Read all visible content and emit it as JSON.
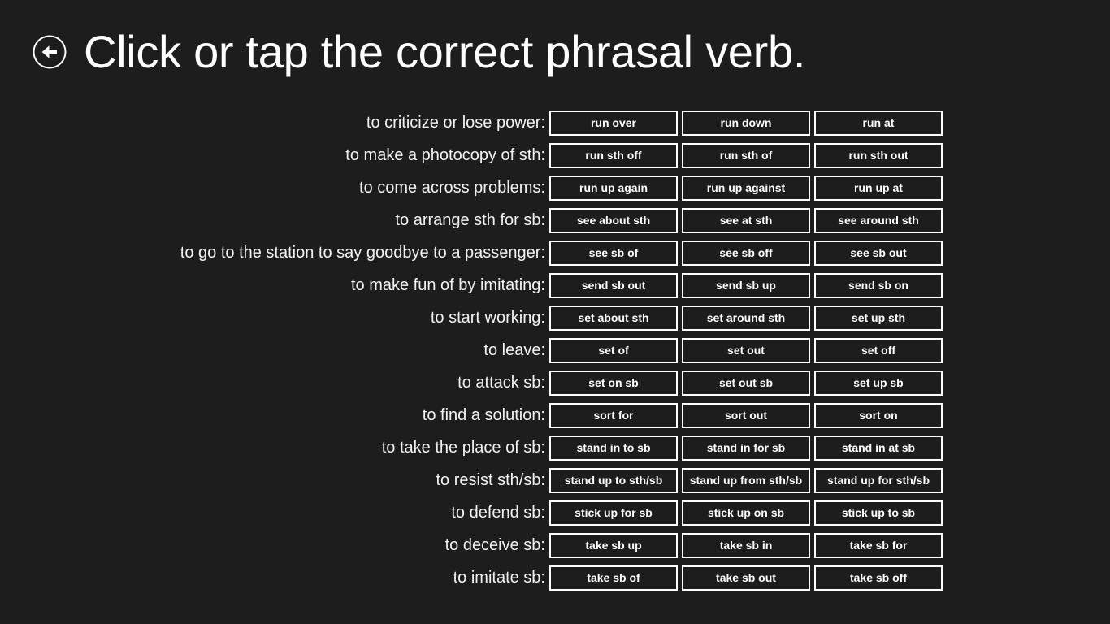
{
  "header": {
    "back_icon": "back-arrow-circle-icon",
    "title": "Click or tap the correct phrasal verb."
  },
  "colors": {
    "background": "#1d1d1d",
    "text": "#ffffff",
    "button_border": "#ffffff",
    "button_fill": "#1d1d1d"
  },
  "quiz": {
    "rows": [
      {
        "label": "to criticize or lose power:",
        "options": [
          "run over",
          "run down",
          "run at"
        ]
      },
      {
        "label": "to make a photocopy of sth:",
        "options": [
          "run sth off",
          "run sth of",
          "run sth out"
        ]
      },
      {
        "label": "to come across problems:",
        "options": [
          "run up again",
          "run up against",
          "run up at"
        ]
      },
      {
        "label": "to arrange sth for sb:",
        "options": [
          "see about sth",
          "see at sth",
          "see around sth"
        ]
      },
      {
        "label": "to go to the station to say goodbye to a passenger:",
        "options": [
          "see sb of",
          "see sb off",
          "see sb out"
        ]
      },
      {
        "label": "to make fun of by imitating:",
        "options": [
          "send sb out",
          "send sb up",
          "send sb on"
        ]
      },
      {
        "label": "to start working:",
        "options": [
          "set about sth",
          "set around sth",
          "set up sth"
        ]
      },
      {
        "label": "to leave:",
        "options": [
          "set of",
          "set out",
          "set off"
        ]
      },
      {
        "label": "to attack sb:",
        "options": [
          "set on sb",
          "set out sb",
          "set up sb"
        ]
      },
      {
        "label": "to find a solution:",
        "options": [
          "sort for",
          "sort out",
          "sort on"
        ]
      },
      {
        "label": "to take the place of sb:",
        "options": [
          "stand in to sb",
          "stand in for sb",
          "stand in at sb"
        ]
      },
      {
        "label": "to resist sth/sb:",
        "options": [
          "stand up to sth/sb",
          "stand up from sth/sb",
          "stand up for sth/sb"
        ]
      },
      {
        "label": "to defend sb:",
        "options": [
          "stick up for sb",
          "stick up on sb",
          "stick up to sb"
        ]
      },
      {
        "label": "to deceive sb:",
        "options": [
          "take sb up",
          "take sb in",
          "take sb for"
        ]
      },
      {
        "label": "to imitate sb:",
        "options": [
          "take sb of",
          "take sb out",
          "take sb off"
        ]
      }
    ]
  }
}
